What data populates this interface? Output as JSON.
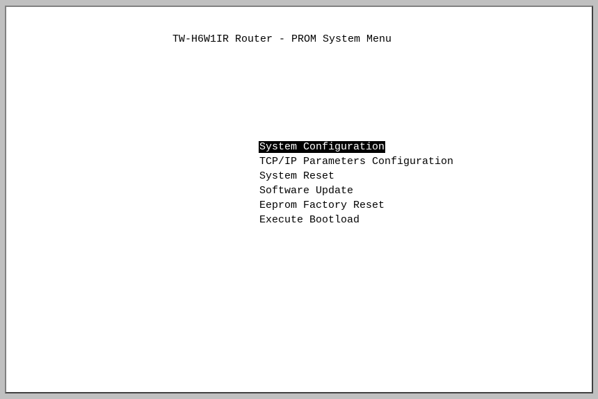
{
  "console": {
    "title": "TW-H6W1IR Router - PROM System Menu",
    "menu": {
      "selected_index": 0,
      "items": [
        {
          "label": "System Configuration"
        },
        {
          "label": "TCP/IP Parameters Configuration"
        },
        {
          "label": "System Reset"
        },
        {
          "label": "Software Update"
        },
        {
          "label": "Eeprom Factory Reset"
        },
        {
          "label": "Execute Bootload"
        }
      ]
    }
  },
  "colors": {
    "background": "#ffffff",
    "text": "#000000",
    "highlight_bg": "#000000",
    "highlight_text": "#ffffff",
    "window_frame": "#c0c0c0"
  }
}
